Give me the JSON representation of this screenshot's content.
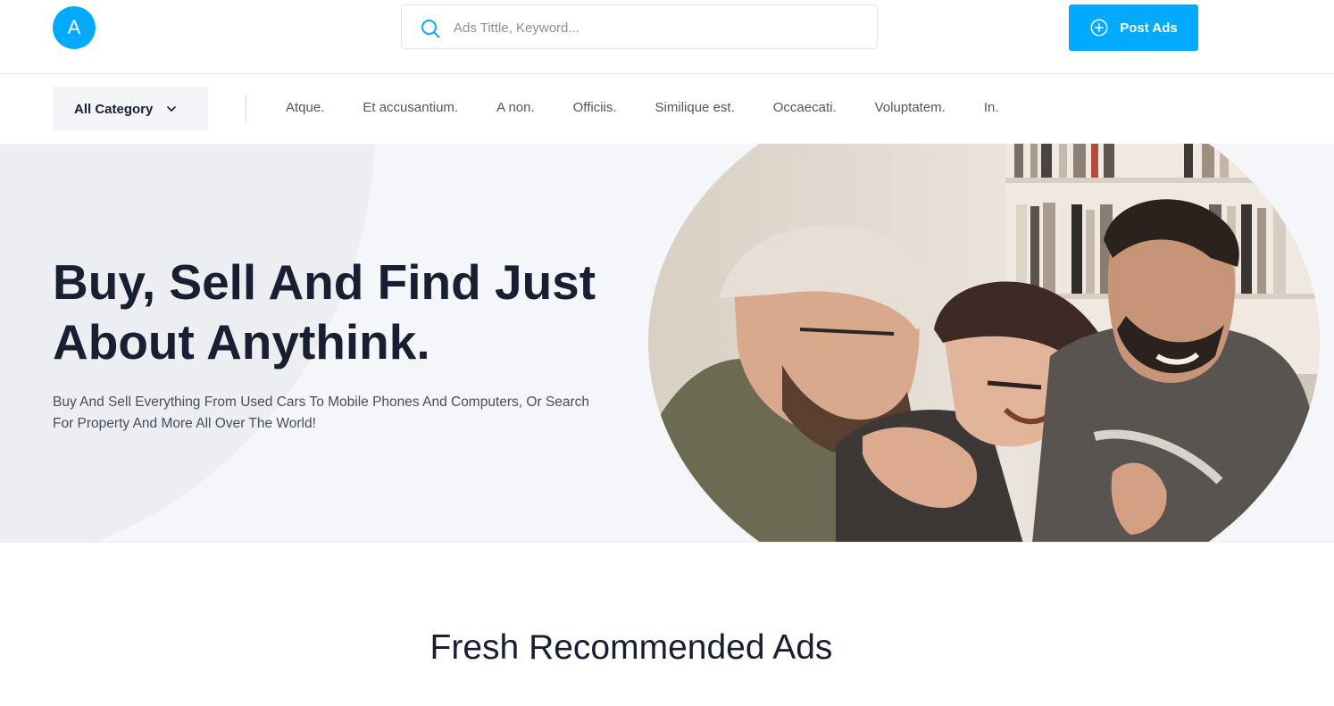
{
  "header": {
    "logo_letter": "A",
    "search_placeholder": "Ads Tittle, Keyword...",
    "post_button_label": "Post Ads"
  },
  "nav": {
    "all_category_label": "All Category",
    "categories": [
      "Atque.",
      "Et accusantium.",
      "A non.",
      "Officiis.",
      "Similique est.",
      "Occaecati.",
      "Voluptatem.",
      "In."
    ]
  },
  "hero": {
    "title_line1": "Buy, Sell And Find Just",
    "title_line2": "About Anythink.",
    "subtitle_line1": "Buy And Sell Everything From Used Cars To Mobile Phones And Computers, Or Search",
    "subtitle_line2": "For Property And More All Over The World!"
  },
  "section": {
    "title": "Fresh Recommended Ads"
  },
  "colors": {
    "accent": "#00aaff",
    "heading": "#191f33",
    "hero_bg": "#f5f6fa"
  },
  "icons": {
    "search": "search-icon",
    "post": "plus-circle-icon",
    "dropdown": "chevron-down-icon"
  }
}
